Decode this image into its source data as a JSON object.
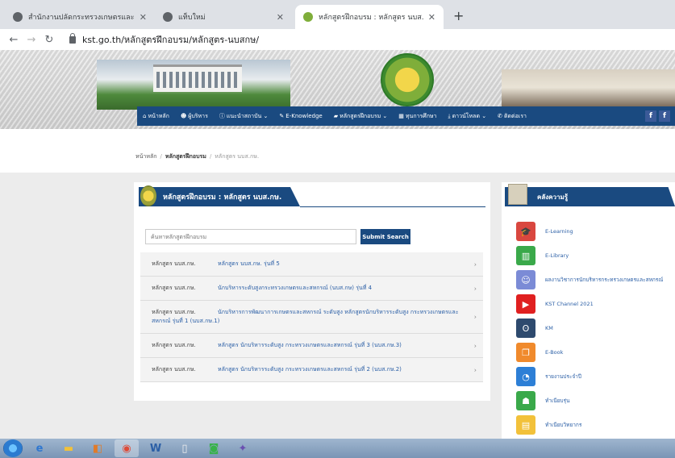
{
  "browser": {
    "tabs": [
      {
        "title": "สำนักงานปลัดกระทรวงเกษตรและ",
        "active": false
      },
      {
        "title": "แท็บใหม่",
        "active": false
      },
      {
        "title": "หลักสูตรฝึกอบรม : หลักสูตร นบส.ก",
        "active": true
      }
    ],
    "new_tab_label": "+",
    "url": "kst.go.th/หลักสูตรฝึกอบรม/หลักสูตร-นบสกษ/"
  },
  "site": {
    "nav": [
      {
        "icon": "home-icon",
        "label": "หน้าหลัก"
      },
      {
        "icon": "people-icon",
        "label": "ผู้บริหาร"
      },
      {
        "icon": "info-icon",
        "label": "แนะนำสถาบัน"
      },
      {
        "icon": "pencil-icon",
        "label": "E-Knowledge"
      },
      {
        "icon": "folder-icon",
        "label": "หลักสูตรฝึกอบรม"
      },
      {
        "icon": "building-icon",
        "label": "ทุนการศึกษา"
      },
      {
        "icon": "download-icon",
        "label": "ดาวน์โหลด"
      },
      {
        "icon": "contact-icon",
        "label": "ติดต่อเรา"
      }
    ],
    "breadcrumb": {
      "home": "หน้าหลัก",
      "section": "หลักสูตรฝึกอบรม",
      "current": "หลักสูตร นบส.กษ."
    }
  },
  "main": {
    "title": "หลักสูตรฝึกอบรม : หลักสูตร นบส.กษ.",
    "search_placeholder": "ค้นหาหลักสูตรฝึกอบรม",
    "search_button": "Submit Search",
    "rows": [
      {
        "category": "หลักสูตร นบส.กษ.",
        "title": "หลักสูตร นบส.กษ. รุ่นที่ 5"
      },
      {
        "category": "หลักสูตร นบส.กษ.",
        "title": "นักบริหารระดับสูงกระทรวงเกษตรและสหกรณ์ (นบส.กษ) รุ่นที่ 4"
      },
      {
        "category": "หลักสูตร นบส.กษ.",
        "title": "นักบริหารการพัฒนาการเกษตรและสหกรณ์ ระดับสูง หลักสูตรนักบริหารระดับสูง กระทรวงเกษตรและสหกรณ์ รุ่นที่ 1 (นบส.กษ.1)"
      },
      {
        "category": "หลักสูตร นบส.กษ.",
        "title": "หลักสูตร นักบริหารระดับสูง กระทรวงเกษตรและสหกรณ์ รุ่นที่ 3 (นบส.กษ.3)"
      },
      {
        "category": "หลักสูตร นบส.กษ.",
        "title": "หลักสูตร นักบริหารระดับสูง กระทรวงเกษตรและสหกรณ์ รุ่นที่ 2 (นบส.กษ.2)"
      }
    ]
  },
  "sidebar": {
    "title": "คลังความรู้",
    "items": [
      {
        "icon": "graduation-cap-icon",
        "color": "#d9473f",
        "label": "E-Learning"
      },
      {
        "icon": "library-icon",
        "color": "#3aa94a",
        "label": "E-Library"
      },
      {
        "icon": "people-photo-icon",
        "color": "#7b8bd6",
        "label": "ผลงานวิชาการนักบริหารกระทรวงเกษตรและสหกรณ์"
      },
      {
        "icon": "youtube-icon",
        "color": "#e02020",
        "label": "KST Channel 2021"
      },
      {
        "icon": "km-icon",
        "color": "#2e4a6e",
        "label": "KM"
      },
      {
        "icon": "ebook-icon",
        "color": "#f08a2c",
        "label": "E-Book"
      },
      {
        "icon": "pie-chart-icon",
        "color": "#2d7fd6",
        "label": "รายงานประจำปี"
      },
      {
        "icon": "group-icon",
        "color": "#3aa94a",
        "label": "ทำเนียบรุ่น"
      },
      {
        "icon": "directory-icon",
        "color": "#f2c13a",
        "label": "ทำเนียบวิทยากร"
      }
    ]
  },
  "taskbar": {
    "apps": [
      "start",
      "ie",
      "explorer",
      "outlook",
      "chrome",
      "word",
      "file",
      "line",
      "misc"
    ]
  }
}
